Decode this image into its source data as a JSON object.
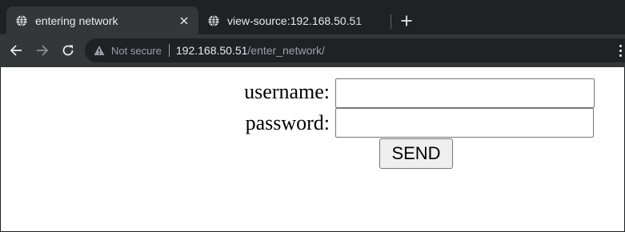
{
  "browser": {
    "tabs": [
      {
        "title": "entering network",
        "active": true,
        "icon": "globe-icon"
      },
      {
        "title": "view-source:192.168.50.51",
        "active": false,
        "icon": "globe-icon"
      }
    ],
    "new_tab_icon": "plus-icon",
    "address": {
      "security_label": "Not secure",
      "host": "192.168.50.51",
      "path": "/enter_network/"
    },
    "colors": {
      "tabstrip": "#202124",
      "toolbar": "#35363a",
      "text": "#e8eaed",
      "muted": "#9aa0a6"
    }
  },
  "page": {
    "form": {
      "username_label": "username:",
      "username_value": "",
      "password_label": "password:",
      "password_value": "",
      "submit_label": "SEND"
    }
  }
}
